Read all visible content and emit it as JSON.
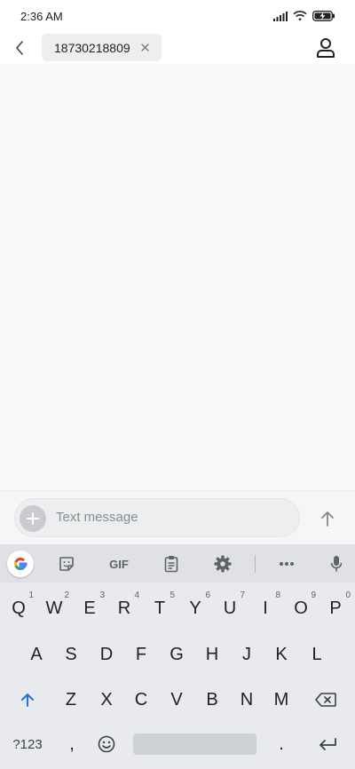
{
  "status_bar": {
    "time": "2:36 AM",
    "icons": [
      "signal-icon",
      "wifi-icon",
      "battery-charging-icon"
    ]
  },
  "header": {
    "back_icon": "back-arrow-icon",
    "recipient": "18730218809",
    "recipient_remove_icon": "close-icon",
    "contact_icon": "person-icon"
  },
  "composer": {
    "add_icon": "plus-icon",
    "placeholder": "Text message",
    "send_icon": "send-arrow-icon"
  },
  "keyboard": {
    "toolbar": {
      "google": "G",
      "sticker_icon": "sticker-icon",
      "gif": "GIF",
      "clipboard_icon": "clipboard-icon",
      "settings_icon": "gear-icon",
      "more_icon": "more-icon",
      "mic_icon": "microphone-icon"
    },
    "row1": [
      {
        "label": "Q",
        "hint": "1"
      },
      {
        "label": "W",
        "hint": "2"
      },
      {
        "label": "E",
        "hint": "3"
      },
      {
        "label": "R",
        "hint": "4"
      },
      {
        "label": "T",
        "hint": "5"
      },
      {
        "label": "Y",
        "hint": "6"
      },
      {
        "label": "U",
        "hint": "7"
      },
      {
        "label": "I",
        "hint": "8"
      },
      {
        "label": "O",
        "hint": "9"
      },
      {
        "label": "P",
        "hint": "0"
      }
    ],
    "row2": [
      "A",
      "S",
      "D",
      "F",
      "G",
      "H",
      "J",
      "K",
      "L"
    ],
    "row3": [
      "Z",
      "X",
      "C",
      "V",
      "B",
      "N",
      "M"
    ],
    "shift_icon": "shift-arrow-icon",
    "backspace_icon": "backspace-icon",
    "symbols_label": "?123",
    "comma_label": ",",
    "emoji_icon": "emoji-icon",
    "period_label": ".",
    "enter_icon": "enter-icon"
  },
  "colors": {
    "accent_blue": "#1a73e8",
    "google_red": "#ea4335",
    "google_yellow": "#fbbc05",
    "google_green": "#34a853",
    "google_blue": "#4285f4"
  }
}
